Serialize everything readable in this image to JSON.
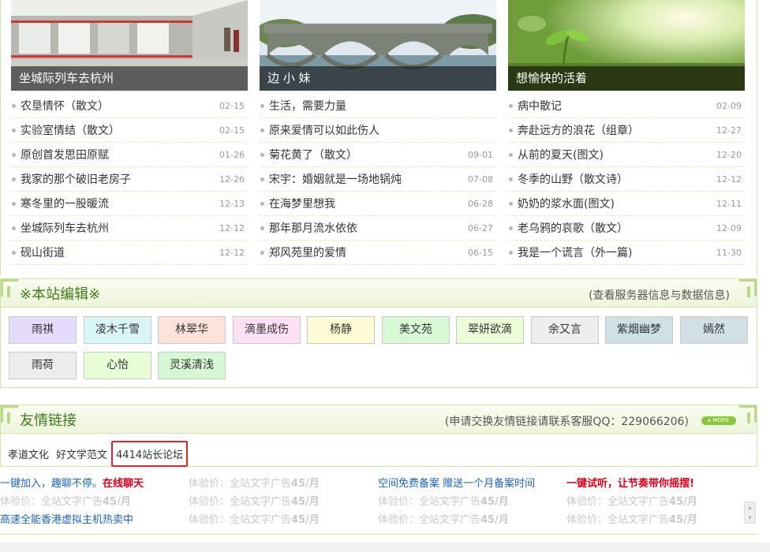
{
  "columns": [
    {
      "caption": "坐城际列车去杭州",
      "items": [
        {
          "title": "农垦情怀（散文）",
          "date": "02-15"
        },
        {
          "title": "实验室情结（散文）",
          "date": "02-15"
        },
        {
          "title": "原创首发思田原赋",
          "date": "01-26"
        },
        {
          "title": "我家的那个破旧老房子",
          "date": "12-26"
        },
        {
          "title": "寒冬里的一股暖流",
          "date": "12-13"
        },
        {
          "title": "坐城际列车去杭州",
          "date": "12-12"
        },
        {
          "title": "砚山街道",
          "date": "12-12"
        }
      ]
    },
    {
      "caption": "边 小 妹",
      "items": [
        {
          "title": "生活，需要力量",
          "date": ""
        },
        {
          "title": "原来爱情可以如此伤人",
          "date": ""
        },
        {
          "title": "菊花黄了（散文）",
          "date": "09-01"
        },
        {
          "title": "宋宇：婚姻就是一场地锅炖",
          "date": "07-08"
        },
        {
          "title": "在海梦里想我",
          "date": "06-28"
        },
        {
          "title": "那年那月流水依依",
          "date": "06-27"
        },
        {
          "title": "郑风苑里的爱情",
          "date": "06-15"
        }
      ]
    },
    {
      "caption": "想愉快的活着",
      "items": [
        {
          "title": "病中散记",
          "date": "02-09"
        },
        {
          "title": "奔赴远方的浪花（组章）",
          "date": "12-27"
        },
        {
          "title": "从前的夏天(图文)",
          "date": "12-20"
        },
        {
          "title": "冬季的山野（散文诗）",
          "date": "12-12"
        },
        {
          "title": "奶奶的浆水面(图文)",
          "date": "12-11"
        },
        {
          "title": "老乌鸦的哀歌（散文）",
          "date": "12-09"
        },
        {
          "title": "我是一个谎言（外一篇)",
          "date": "11-30"
        }
      ]
    }
  ],
  "editors_section": {
    "title": "※本站编辑※",
    "extra": "(查看服务器信息与数据信息)",
    "editors": [
      {
        "name": "雨祺",
        "bg": "#e5dcfb"
      },
      {
        "name": "凌木千雪",
        "bg": "#d9f5f8"
      },
      {
        "name": "林翠华",
        "bg": "#fde3dc"
      },
      {
        "name": "滴墨成伤",
        "bg": "#fde0f4"
      },
      {
        "name": "杨静",
        "bg": "#fdfbd3"
      },
      {
        "name": "美文苑",
        "bg": "#d8f9d5"
      },
      {
        "name": "翠妍欲滴",
        "bg": "#ecfcd8"
      },
      {
        "name": "余又言",
        "bg": "#eeeeee"
      },
      {
        "name": "紫烟幽梦",
        "bg": "#cfe0e6"
      },
      {
        "name": "嫣然",
        "bg": "#d2e0e6"
      },
      {
        "name": "雨荷",
        "bg": "#ececec"
      },
      {
        "name": "心怡",
        "bg": "#e9fcd8"
      },
      {
        "name": "灵溪清浅",
        "bg": "#d6f7d4"
      }
    ]
  },
  "links_section": {
    "title": "友情链接",
    "extra": "(申请交换友情链接请联系客服QQ：229066206)",
    "more_label": "MORE",
    "links": [
      "孝道文化",
      "好文学范文"
    ],
    "highlighted_link": "4414站长论坛"
  },
  "ads": {
    "row1": [
      "一键加入，趣聊不停。",
      "在线聊天",
      "空间免费备案 赠送一个月备案时间",
      "一键试听，让节奏带你摇摆!"
    ],
    "trial_prefix": "体验价：全站文字广告",
    "trial_price": "45/月",
    "row3_first": "高速全能香港虚拟主机热卖中"
  },
  "colors": {
    "green_title": "#3f7a18",
    "panel_border": "#cfe3ae",
    "ad_blue": "#1e63b8",
    "ad_red": "#d9001b",
    "highlight_red": "#e8222b"
  }
}
